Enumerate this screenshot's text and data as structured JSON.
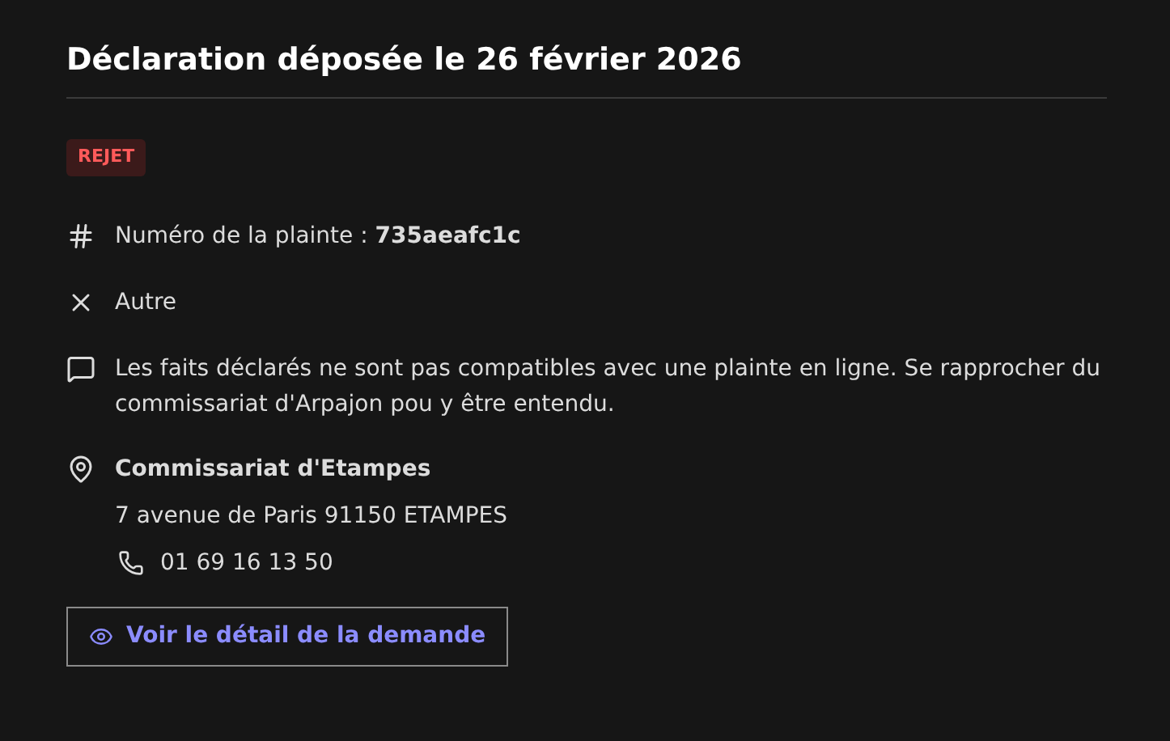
{
  "title": "Déclaration déposée le 26 février 2026",
  "status": {
    "label": "REJET",
    "kind": "error"
  },
  "details": [
    {
      "kind": "number",
      "text": "Numéro de la plainte : **735aeafc1c**"
    },
    {
      "kind": "category",
      "text": "Autre"
    },
    {
      "kind": "comment",
      "text": "Les faits déclarés ne sont pas compatibles avec une plainte en ligne. Se rapprocher du commissariat d'Arpajon pou y être entendu."
    }
  ],
  "office": {
    "name": "Commissariat d'Etampes",
    "address": "7 avenue de Paris 91150 ETAMPES",
    "phone": "01 69 16 13 50"
  },
  "action": "Voir le détail de la demande"
}
